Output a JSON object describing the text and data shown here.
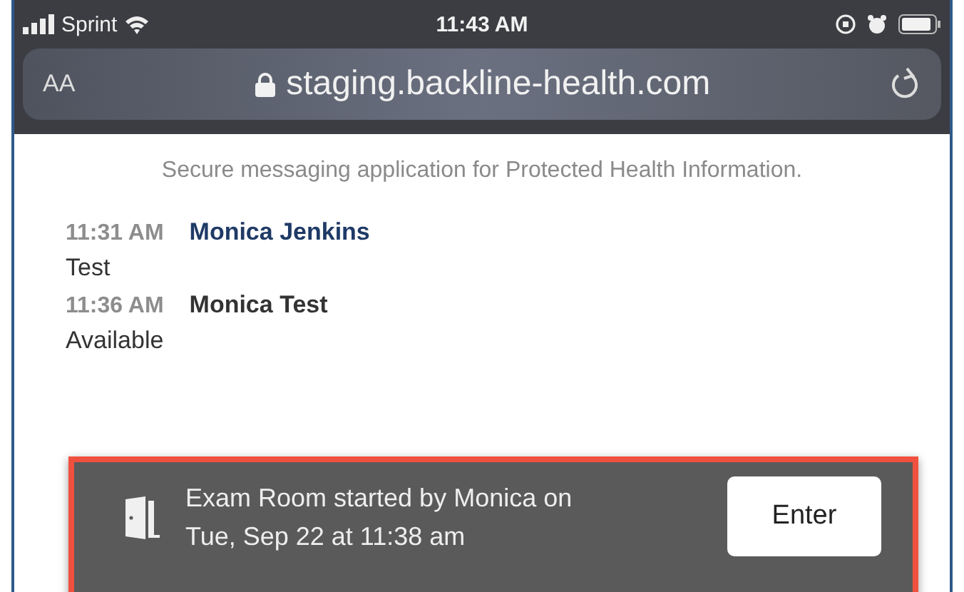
{
  "status_bar": {
    "carrier": "Sprint",
    "time": "11:43 AM"
  },
  "address_bar": {
    "text_size_button": "AA",
    "url": "staging.backline-health.com"
  },
  "subtitle": "Secure messaging application for Protected Health Information.",
  "messages": [
    {
      "time": "11:31 AM",
      "sender": "Monica Jenkins",
      "highlighted": true,
      "text": "Test"
    },
    {
      "time": "11:36 AM",
      "sender": "Monica Test",
      "highlighted": false,
      "text": "Available"
    }
  ],
  "notification": {
    "lines": [
      "Exam Room started by Monica on",
      "Tue, Sep 22 at 11:38 am"
    ],
    "button": "Enter"
  }
}
